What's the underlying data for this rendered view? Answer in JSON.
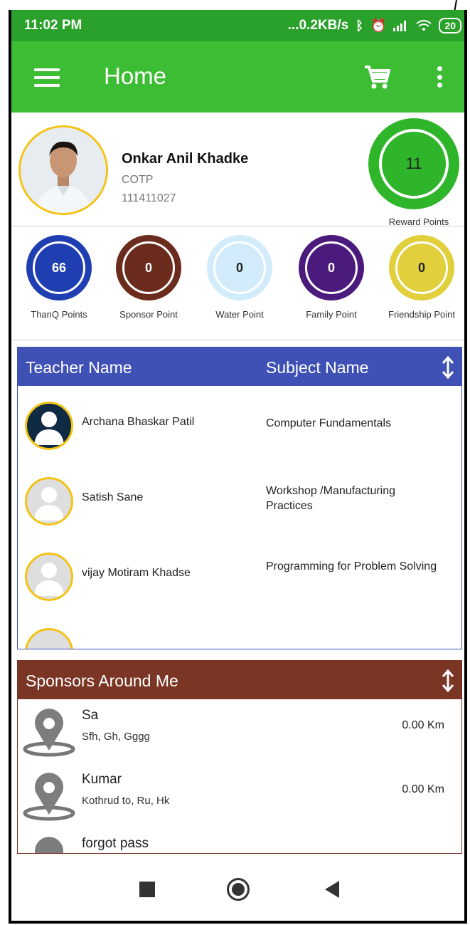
{
  "status_bar": {
    "time": "11:02 PM",
    "network_speed": "...0.2KB/s",
    "battery": "20"
  },
  "app_bar": {
    "title": "Home",
    "icons": [
      "menu-icon",
      "cart-icon",
      "more-vert-icon"
    ]
  },
  "profile": {
    "name": "Onkar Anil Khadke",
    "department": "COTP",
    "id": "111411027",
    "reward_points": "11",
    "reward_label": "Reward Points"
  },
  "points": [
    {
      "value": "66",
      "label": "ThanQ Points",
      "color": "#1e3eb1"
    },
    {
      "value": "0",
      "label": "Sponsor Point",
      "color": "#6b2b1d"
    },
    {
      "value": "0",
      "label": "Water Point",
      "color": "#d3ecfb"
    },
    {
      "value": "0",
      "label": "Family Point",
      "color": "#4b1a7d"
    },
    {
      "value": "0",
      "label": "Friendship Point",
      "color": "#e1cf3c"
    }
  ],
  "teachers": {
    "header_teacher": "Teacher Name",
    "header_subject": "Subject Name",
    "rows": [
      {
        "name": "Archana Bhaskar Patil",
        "subject": "Computer Fundamentals"
      },
      {
        "name": "Satish Sane",
        "subject": "Workshop /Manufacturing Practices"
      },
      {
        "name": "vijay Motiram Khadse",
        "subject": "Programming for Problem Solving"
      }
    ]
  },
  "sponsors": {
    "header": "Sponsors Around Me",
    "rows": [
      {
        "name": "Sa",
        "address": "Sfh, Gh, Gggg",
        "distance": "0.00 Km"
      },
      {
        "name": "Kumar",
        "address": "Kothrud to, Ru, Hk",
        "distance": "0.00 Km"
      },
      {
        "name": "forgot pass",
        "address": "",
        "distance": ""
      }
    ]
  },
  "colors": {
    "status_green": "#2aa12a",
    "appbar_green": "#3cbd33",
    "teacher_header": "#3f51b5",
    "sponsor_header": "#7a3524",
    "avatar_ring": "#f3c316"
  }
}
